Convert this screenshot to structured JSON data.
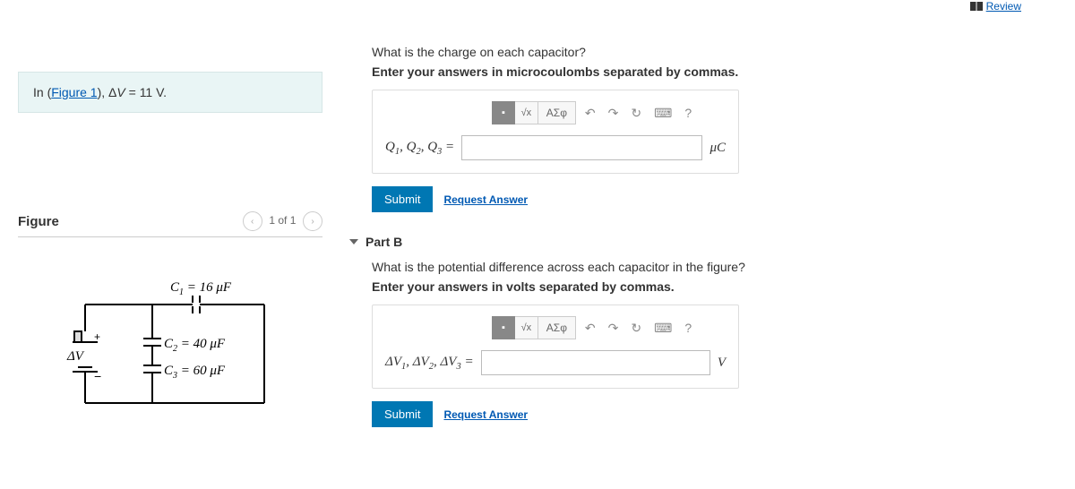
{
  "review": "Review",
  "info": {
    "prefix": "In (",
    "figlink": "Figure 1",
    "suffix": "), ΔV = 11 V."
  },
  "figure": {
    "title": "Figure",
    "count": "1 of 1",
    "labels": {
      "c1": "C_1 = 16 μF",
      "c2": "C_2 = 40 μF",
      "c3": "C_3 = 60 μF",
      "dv": "ΔV"
    }
  },
  "partA": {
    "question": "What is the charge on each capacitor?",
    "instr": "Enter your answers in microcoulombs separated by commas.",
    "lhs": "Q₁, Q₂, Q₃ =",
    "unit": "μC",
    "submit": "Submit",
    "request": "Request Answer",
    "value": "",
    "tool_greek": "ΑΣφ"
  },
  "partB": {
    "title": "Part B",
    "question": "What is the potential difference across each capacitor in the figure?",
    "instr": "Enter your answers in volts separated by commas.",
    "lhs": "ΔV₁, ΔV₂, ΔV₃ =",
    "unit": "V",
    "submit": "Submit",
    "request": "Request Answer",
    "value": "",
    "tool_greek": "ΑΣφ"
  }
}
